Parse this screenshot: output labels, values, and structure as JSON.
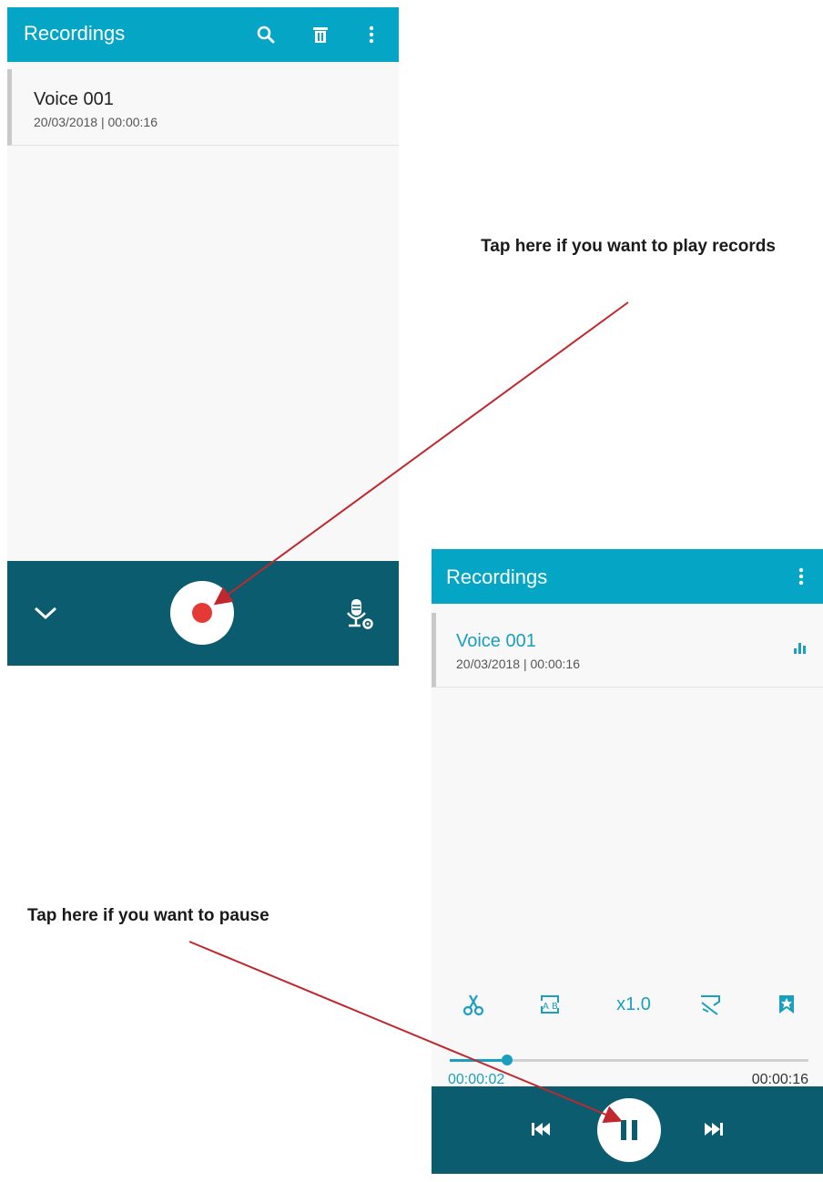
{
  "screen1": {
    "app_title": "Recordings",
    "icons": {
      "search": "search-icon",
      "delete": "trash-icon",
      "menu": "more-vert-icon",
      "collapse": "chevron-down-icon",
      "record": "record-icon",
      "settings": "mic-settings-icon"
    },
    "recording": {
      "name": "Voice 001",
      "details": "20/03/2018 | 00:00:16"
    }
  },
  "screen2": {
    "app_title": "Recordings",
    "icons": {
      "menu": "more-vert-icon",
      "playing": "equalizer-icon",
      "trim": "scissors-icon",
      "repeat_ab": "ab-repeat-icon",
      "skip_silence": "skip-silence-icon",
      "bookmark": "bookmark-icon",
      "prev": "skip-previous-icon",
      "pause": "pause-icon",
      "next": "skip-next-icon"
    },
    "recording": {
      "name": "Voice 001",
      "details": "20/03/2018 | 00:00:16"
    },
    "speed": "x1.0",
    "current_time": "00:00:02",
    "total_time": "00:00:16",
    "progress": 0.16
  },
  "annotations": {
    "callout_play": "Tap here if you want to play records",
    "callout_pause": "Tap here if you want to pause"
  },
  "colors": {
    "appbar": "#05a5c6",
    "bottombar": "#0a5c6e",
    "accent": "#1a9fc0",
    "record": "#e53935",
    "arrow": "#c0282d"
  }
}
